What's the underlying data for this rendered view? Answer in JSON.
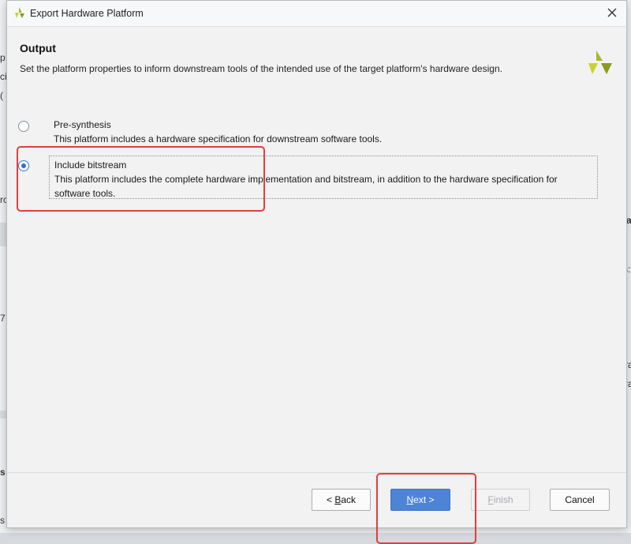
{
  "dialog": {
    "title": "Export Hardware Platform",
    "heading": "Output",
    "description": "Set the platform properties to inform downstream tools of the intended use of the target platform's hardware design."
  },
  "options": [
    {
      "label": "Pre-synthesis",
      "description": "This platform includes a hardware specification for downstream software tools.",
      "selected": false
    },
    {
      "label": "Include bitstream",
      "description_line1": "This platform includes the complete hardware implementation and bitstream, in addition to the hardware specification for",
      "description_line2": "software tools.",
      "selected": true
    }
  ],
  "buttons": {
    "back_mnemonic": "B",
    "back_rest": "ack",
    "back_prefix": "< ",
    "next_mnemonic": "N",
    "next_rest": "ext >",
    "finish_mnemonic": "F",
    "finish_rest": "inish",
    "cancel": "Cancel"
  },
  "background_fragments": [
    "p",
    "ci",
    "(",
    "ro",
    "7",
    "ta",
    "s:",
    "ra",
    "ra",
    "s",
    "s"
  ],
  "colors": {
    "accent": "#4d84d6",
    "annotation": "#e23d3d",
    "brand": "#a8b82a"
  },
  "icons": {
    "app": "xilinx-logo-icon",
    "close": "close-icon",
    "brand": "xilinx-logo-icon"
  }
}
